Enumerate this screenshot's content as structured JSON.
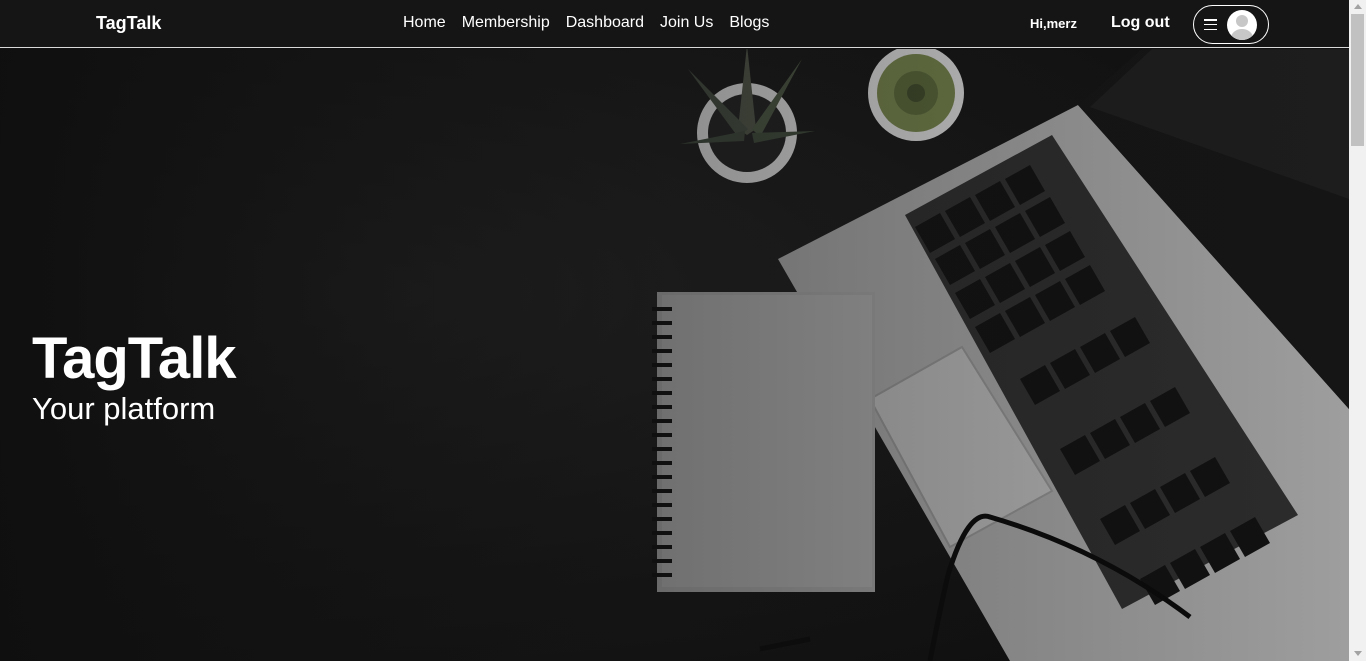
{
  "navbar": {
    "brand": "TagTalk",
    "links": [
      "Home",
      "Membership",
      "Dashboard",
      "Join Us",
      "Blogs"
    ],
    "greeting": "Hi,merz",
    "logout_label": "Log out",
    "menu_icon": "hamburger-icon",
    "avatar_icon": "user-avatar-icon"
  },
  "hero": {
    "title": "TagTalk",
    "subtitle": "Your platform",
    "background_image": "desk with laptop, notebook, plants and glasses"
  },
  "colors": {
    "navbar_bg": "#151515",
    "hero_bg": "#151515",
    "text": "#ffffff"
  }
}
